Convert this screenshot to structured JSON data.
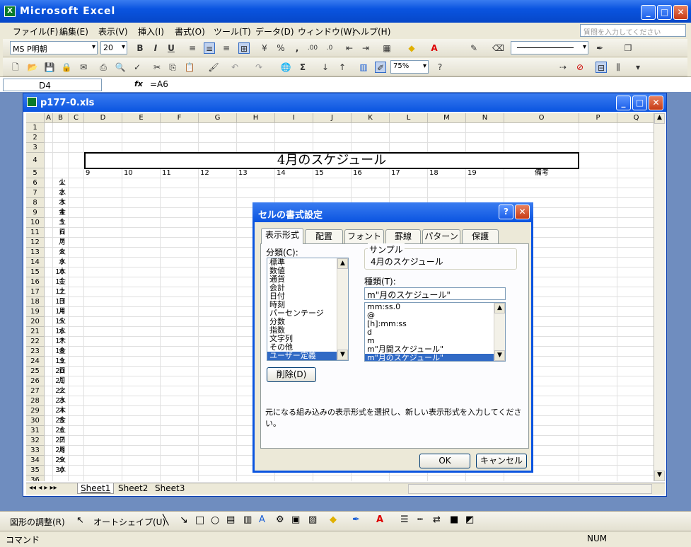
{
  "app": {
    "title": "Microsoft Excel"
  },
  "menu": [
    "ファイル(F)",
    "編集(E)",
    "表示(V)",
    "挿入(I)",
    "書式(O)",
    "ツール(T)",
    "データ(D)",
    "ウィンドウ(W)",
    "ヘルプ(H)"
  ],
  "ask_placeholder": "質問を入力してください",
  "format_toolbar": {
    "font": "MS P明朝",
    "size": "20"
  },
  "std_toolbar": {
    "zoom": "75%"
  },
  "formula": {
    "cell": "D4",
    "fx": "fx",
    "value": "=A6"
  },
  "workbook": {
    "title": "p177-0.xls"
  },
  "columns": [
    "A",
    "B",
    "C",
    "D",
    "E",
    "F",
    "G",
    "H",
    "I",
    "J",
    "K",
    "L",
    "M",
    "N",
    "O",
    "P",
    "Q"
  ],
  "sheet": {
    "title": "4月のスケジュール",
    "hours": [
      "9",
      "10",
      "11",
      "12",
      "13",
      "14",
      "15",
      "16",
      "17",
      "18",
      "19"
    ],
    "memo_header": "備考",
    "rows": [
      [
        "1",
        "火"
      ],
      [
        "2",
        "水"
      ],
      [
        "3",
        "木"
      ],
      [
        "4",
        "金"
      ],
      [
        "5",
        "土"
      ],
      [
        "6",
        "日"
      ],
      [
        "7",
        "月"
      ],
      [
        "8",
        "火"
      ],
      [
        "9",
        "水"
      ],
      [
        "10",
        "木"
      ],
      [
        "11",
        "金"
      ],
      [
        "12",
        "土"
      ],
      [
        "13",
        "日"
      ],
      [
        "14",
        "月"
      ],
      [
        "15",
        "火"
      ],
      [
        "16",
        "水"
      ],
      [
        "17",
        "木"
      ],
      [
        "18",
        "金"
      ],
      [
        "19",
        "土"
      ],
      [
        "20",
        "日"
      ],
      [
        "21",
        "月"
      ],
      [
        "22",
        "火"
      ],
      [
        "23",
        "水"
      ],
      [
        "24",
        "木"
      ],
      [
        "25",
        "金"
      ],
      [
        "26",
        "土"
      ],
      [
        "27",
        "日"
      ],
      [
        "28",
        "月"
      ],
      [
        "29",
        "火"
      ],
      [
        "30",
        "水"
      ]
    ]
  },
  "sheet_tabs": [
    "Sheet1",
    "Sheet2",
    "Sheet3"
  ],
  "dialog": {
    "title": "セルの書式設定",
    "tabs": [
      "表示形式",
      "配置",
      "フォント",
      "罫線",
      "パターン",
      "保護"
    ],
    "category_label": "分類(C):",
    "categories": [
      "標準",
      "数値",
      "通貨",
      "会計",
      "日付",
      "時刻",
      "パーセンテージ",
      "分数",
      "指数",
      "文字列",
      "その他",
      "ユーザー定義"
    ],
    "sample_label": "サンプル",
    "sample_value": "4月のスケジュール",
    "type_label": "種類(T):",
    "type_value": "m\"月のスケジュール\"",
    "types": [
      "mm:ss.0",
      "@",
      "[h]:mm:ss",
      "d",
      "m",
      "m\"月間スケジュール\"",
      "m\"月のスケジュール\""
    ],
    "delete_button": "削除(D)",
    "description": "元になる組み込みの表示形式を選択し、新しい表示形式を入力してください。",
    "ok": "OK",
    "cancel": "キャンセル"
  },
  "drawbar": {
    "adjust": "図形の調整(R)",
    "autoshape": "オートシェイプ(U)"
  },
  "status": {
    "mode": "コマンド",
    "num": "NUM"
  }
}
